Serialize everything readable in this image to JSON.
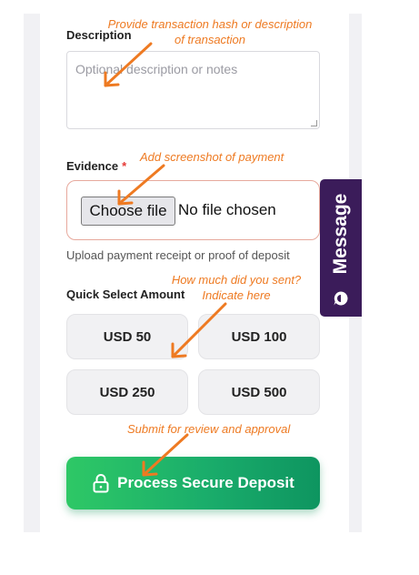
{
  "form": {
    "description_label": "Description",
    "description_placeholder": "Optional description or notes",
    "evidence_label": "Evidence",
    "required_marker": "*",
    "file_button_label": "Choose file",
    "file_status": "No file chosen",
    "evidence_helper": "Upload payment receipt or proof of deposit",
    "quick_select_label": "Quick Select Amount",
    "amounts": [
      "USD 50",
      "USD 100",
      "USD 250",
      "USD 500"
    ],
    "submit_label": "Process Secure Deposit"
  },
  "message_tab": {
    "label": "Message",
    "icon": "chat-icon"
  },
  "annotations": {
    "description_line1": "Provide transaction hash or description",
    "description_line2": "of transaction",
    "evidence": "Add screenshot of payment",
    "amount_line1": "How much did you sent?",
    "amount_line2": "Indicate here",
    "submit": "Submit for review and approval"
  },
  "colors": {
    "annotation": "#ee7a22",
    "submit_start": "#2ec866",
    "submit_end": "#0e9560",
    "message_tab": "#3b1c5a",
    "required": "#e53935"
  }
}
